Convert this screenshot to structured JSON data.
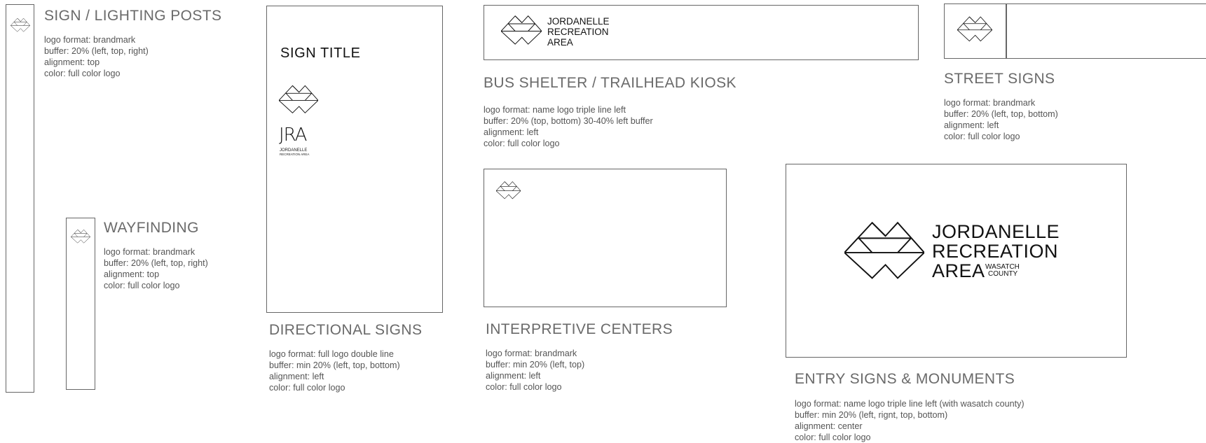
{
  "sections": {
    "sign_lighting": {
      "title": "SIGN / LIGHTING POSTS",
      "specs": [
        "logo format: brandmark",
        "buffer: 20% (left, top, right)",
        "alignment: top",
        "color: full color logo"
      ]
    },
    "wayfinding": {
      "title": "WAYFINDING",
      "specs": [
        "logo format: brandmark",
        "buffer: 20% (left, top, right)",
        "alignment: top",
        "color: full color logo"
      ]
    },
    "directional": {
      "title": "DIRECTIONAL SIGNS",
      "sign_title": "SIGN TITLE",
      "logo_mono": "JRA",
      "logo_small_lines": [
        "JORDANELLE",
        "RECREATION AREA"
      ],
      "specs": [
        "logo format: full logo double line",
        "buffer: min 20% (left, top, bottom)",
        "alignment: left",
        "color: full color logo"
      ]
    },
    "bus_shelter": {
      "title": "BUS SHELTER / TRAILHEAD KIOSK",
      "logo_lines": [
        "JORDANELLE",
        "RECREATION",
        "AREA"
      ],
      "specs": [
        "logo format: name logo triple line left",
        "buffer: 20% (top, bottom) 30-40% left buffer",
        "alignment: left",
        "color: full color logo"
      ]
    },
    "street": {
      "title": "STREET SIGNS",
      "specs": [
        "logo format: brandmark",
        "buffer: 20% (left, top, bottom)",
        "alignment: left",
        "color: full color logo"
      ]
    },
    "interpretive": {
      "title": "INTERPRETIVE CENTERS",
      "specs": [
        "logo format: brandmark",
        "buffer: min 20% (left, top)",
        "alignment: left",
        "color: full color logo"
      ]
    },
    "entry": {
      "title": "ENTRY SIGNS & MONUMENTS",
      "logo_lines": [
        "JORDANELLE",
        "RECREATION",
        "AREA"
      ],
      "wasatch_lines": [
        "WASATCH",
        "COUNTY"
      ],
      "specs": [
        "logo format: name logo triple line left (with wasatch county)",
        "buffer: min 20% (left, rignt, top, bottom)",
        "alignment: center",
        "color: full color logo"
      ]
    }
  },
  "icons": {
    "brandmark": "mountain-reflection-brandmark-icon"
  },
  "colors": {
    "title_gray": "#6a6a6a",
    "text_gray": "#555555",
    "outline_gray": "#666666",
    "logo_black": "#111111"
  }
}
